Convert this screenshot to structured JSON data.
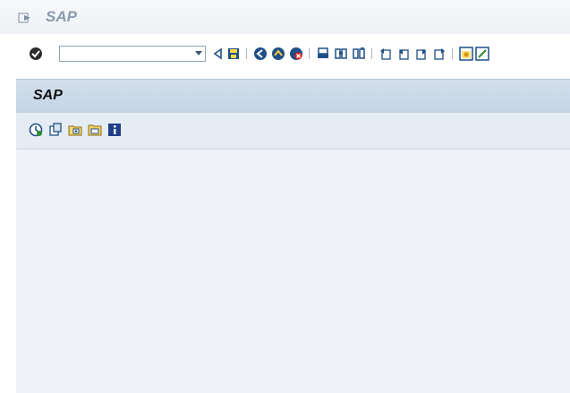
{
  "window": {
    "title": "SAP"
  },
  "command_field": {
    "value": "",
    "placeholder": ""
  },
  "page": {
    "title": "SAP"
  },
  "toolbar_icons": [
    "enter-icon",
    "back-icon",
    "save-icon",
    "green-back-icon",
    "exit-icon",
    "cancel-icon",
    "print-icon",
    "find-icon",
    "find-next-icon",
    "first-page-icon",
    "previous-page-icon",
    "next-page-icon",
    "last-page-icon",
    "create-session-icon"
  ],
  "app_toolbar_icons": [
    "execute-icon",
    "display-icon",
    "add-favorite-icon",
    "change-favorite-icon",
    "info-icon"
  ],
  "colors": {
    "title_text": "#8a9aae",
    "header_bg": "#cfdcea",
    "content_bg": "#eef2f6",
    "icon_blue": "#1f4f86",
    "icon_green": "#2e8b2e"
  }
}
